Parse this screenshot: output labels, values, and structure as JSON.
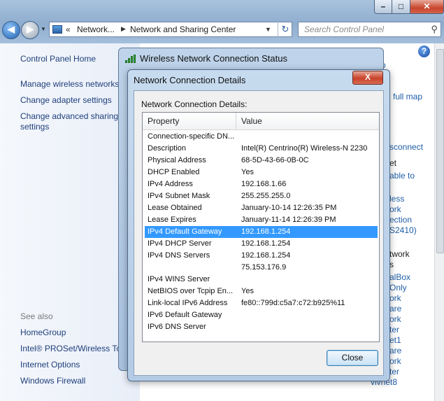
{
  "window": {
    "minimize": "–",
    "maximize": "□",
    "close": "✕"
  },
  "address": {
    "chevron": "«",
    "crumbs": [
      "Network...",
      "Network and Sharing Center"
    ],
    "search_placeholder": "Search Control Panel"
  },
  "left_nav": {
    "home": "Control Panel Home",
    "links": [
      "Manage wireless networks",
      "Change adapter settings",
      "Change advanced sharing settings"
    ],
    "see_also": "See also",
    "see_also_links": [
      "HomeGroup",
      "Intel® PROSet/Wireless To",
      "Internet Options",
      "Windows Firewall"
    ]
  },
  "background_fragments": [
    "p",
    "full map",
    "sconnect",
    "et",
    "able to",
    "less",
    "ork",
    "ection",
    "S2410)",
    "twork",
    "s",
    "alBox",
    "Only",
    "ork",
    "are",
    "ork",
    "ter",
    "et1",
    "are",
    "ork",
    "ter",
    "vivnet8"
  ],
  "status_window": {
    "title": "Wireless Network Connection Status"
  },
  "details_dialog": {
    "title": "Network Connection Details",
    "close_glyph": "X",
    "label": "Network Connection Details:",
    "columns": [
      "Property",
      "Value"
    ],
    "rows": [
      {
        "property": "Connection-specific DN...",
        "value": ""
      },
      {
        "property": "Description",
        "value": "Intel(R) Centrino(R) Wireless-N 2230"
      },
      {
        "property": "Physical Address",
        "value": "68-5D-43-66-0B-0C"
      },
      {
        "property": "DHCP Enabled",
        "value": "Yes"
      },
      {
        "property": "IPv4 Address",
        "value": "192.168.1.66"
      },
      {
        "property": "IPv4 Subnet Mask",
        "value": "255.255.255.0"
      },
      {
        "property": "Lease Obtained",
        "value": "January-10-14 12:26:35 PM"
      },
      {
        "property": "Lease Expires",
        "value": "January-11-14 12:26:39 PM"
      },
      {
        "property": "IPv4 Default Gateway",
        "value": "192.168.1.254",
        "selected": true
      },
      {
        "property": "IPv4 DHCP Server",
        "value": "192.168.1.254"
      },
      {
        "property": "IPv4 DNS Servers",
        "value": "192.168.1.254"
      },
      {
        "property": "",
        "value": "75.153.176.9"
      },
      {
        "property": "IPv4 WINS Server",
        "value": ""
      },
      {
        "property": "NetBIOS over Tcpip En...",
        "value": "Yes"
      },
      {
        "property": "Link-local IPv6 Address",
        "value": "fe80::799d:c5a7:c72:b925%11"
      },
      {
        "property": "IPv6 Default Gateway",
        "value": ""
      },
      {
        "property": "IPv6 DNS Server",
        "value": ""
      }
    ],
    "close_button": "Close"
  },
  "colors": {
    "selection": "#3399ff",
    "link": "#1e3e7b",
    "title_bar": "#b4cbe6"
  }
}
